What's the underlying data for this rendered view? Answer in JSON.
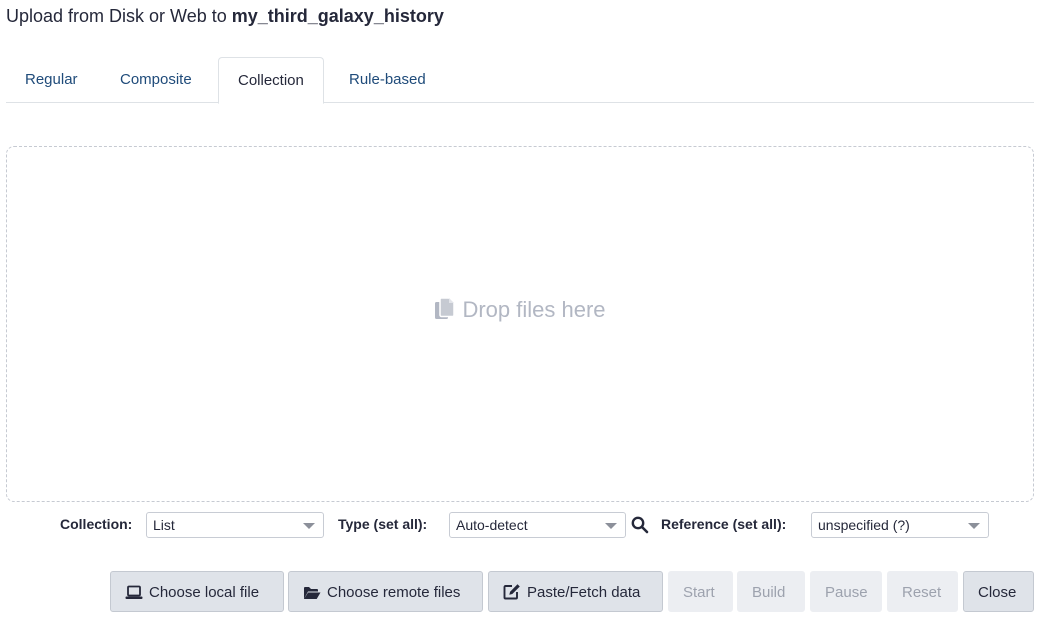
{
  "header": {
    "title_prefix": "Upload from Disk or Web to ",
    "history_name": "my_third_galaxy_history"
  },
  "tabs": [
    {
      "label": "Regular",
      "active": false
    },
    {
      "label": "Composite",
      "active": false
    },
    {
      "label": "Collection",
      "active": true
    },
    {
      "label": "Rule-based",
      "active": false
    }
  ],
  "dropzone": {
    "icon": "copy-icon",
    "message": "Drop files here"
  },
  "settings": {
    "collection_label": "Collection:",
    "collection_value": "List",
    "type_label": "Type (set all):",
    "type_value": "Auto-detect",
    "reference_label": "Reference (set all):",
    "reference_value": "unspecified (?)"
  },
  "footer": {
    "choose_local": "Choose local file",
    "choose_remote": "Choose remote files",
    "paste_fetch": "Paste/Fetch data",
    "start": "Start",
    "build": "Build",
    "pause": "Pause",
    "reset": "Reset",
    "close": "Close"
  },
  "colors": {
    "tab_link": "#1f4b7a",
    "text": "#25283a",
    "muted": "#b2b7c3",
    "button_bg": "#dfe3e9"
  }
}
